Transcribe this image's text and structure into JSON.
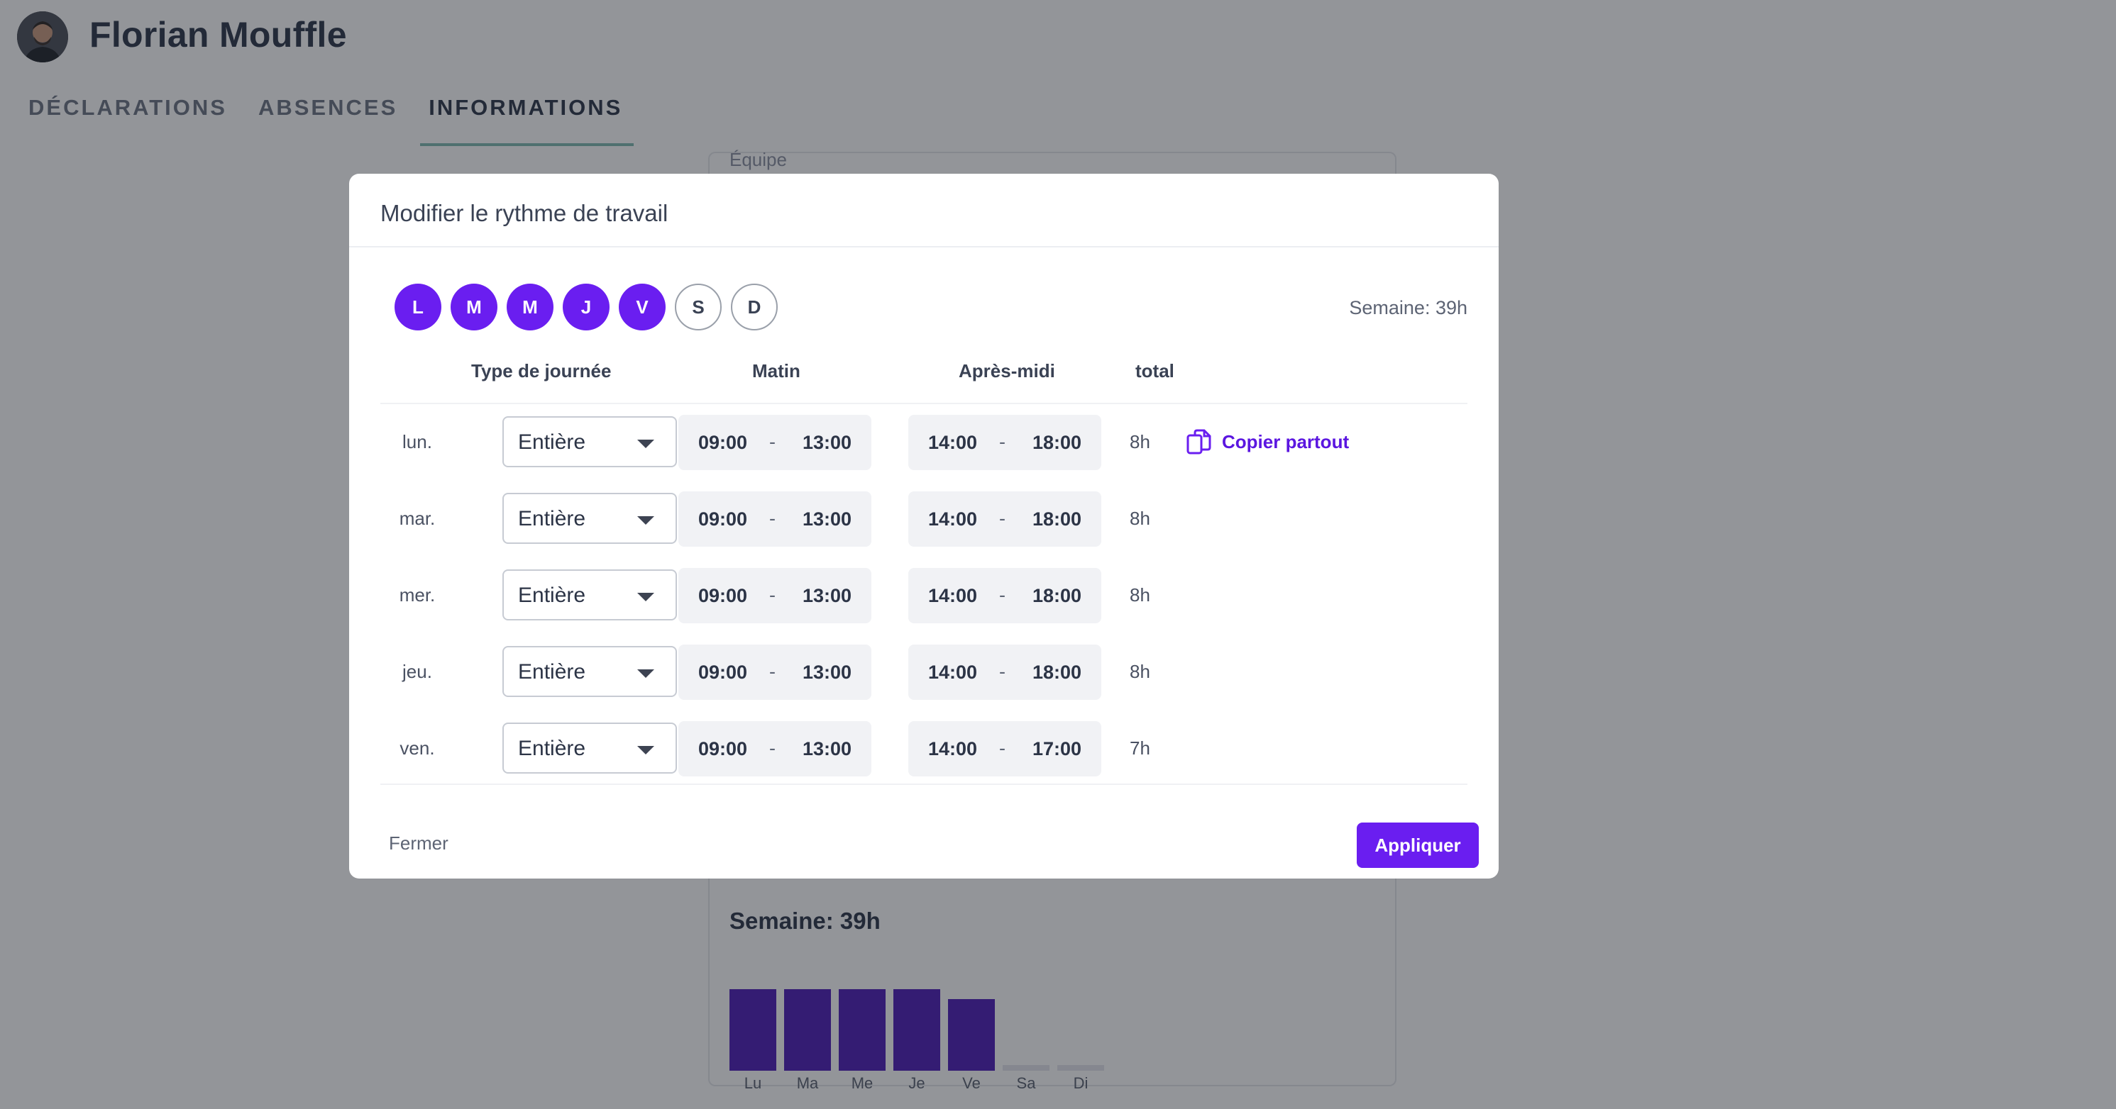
{
  "user": {
    "name": "Florian Mouffle"
  },
  "tabs": [
    {
      "label": "DÉCLARATIONS",
      "active": false
    },
    {
      "label": "ABSENCES",
      "active": false
    },
    {
      "label": "INFORMATIONS",
      "active": true
    }
  ],
  "background_card": {
    "team_label": "Équipe",
    "week_title": "Semaine: 39h",
    "chart_data": {
      "type": "bar",
      "categories": [
        "Lu",
        "Ma",
        "Me",
        "Je",
        "Ve",
        "Sa",
        "Di"
      ],
      "values": [
        8,
        8,
        8,
        8,
        7,
        0,
        0
      ],
      "unit": "h"
    }
  },
  "modal": {
    "title": "Modifier le rythme de travail",
    "week_total": "Semaine: 39h",
    "day_pills": [
      {
        "letter": "L",
        "active": true
      },
      {
        "letter": "M",
        "active": true
      },
      {
        "letter": "M",
        "active": true
      },
      {
        "letter": "J",
        "active": true
      },
      {
        "letter": "V",
        "active": true
      },
      {
        "letter": "S",
        "active": false
      },
      {
        "letter": "D",
        "active": false
      }
    ],
    "columns": {
      "day_type": "Type de journée",
      "morning": "Matin",
      "afternoon": "Après-midi",
      "total": "total"
    },
    "rows": [
      {
        "day": "lun.",
        "type": "Entière",
        "am_start": "09:00",
        "am_end": "13:00",
        "pm_start": "14:00",
        "pm_end": "18:00",
        "total": "8h"
      },
      {
        "day": "mar.",
        "type": "Entière",
        "am_start": "09:00",
        "am_end": "13:00",
        "pm_start": "14:00",
        "pm_end": "18:00",
        "total": "8h"
      },
      {
        "day": "mer.",
        "type": "Entière",
        "am_start": "09:00",
        "am_end": "13:00",
        "pm_start": "14:00",
        "pm_end": "18:00",
        "total": "8h"
      },
      {
        "day": "jeu.",
        "type": "Entière",
        "am_start": "09:00",
        "am_end": "13:00",
        "pm_start": "14:00",
        "pm_end": "18:00",
        "total": "8h"
      },
      {
        "day": "ven.",
        "type": "Entière",
        "am_start": "09:00",
        "am_end": "13:00",
        "pm_start": "14:00",
        "pm_end": "17:00",
        "total": "7h"
      }
    ],
    "copy_all_label": "Copier partout",
    "close_label": "Fermer",
    "apply_label": "Appliquer",
    "dash": "-"
  },
  "colors": {
    "accent": "#6a1ef0",
    "chart_bar": "#4c1bb8",
    "tab_underline": "#7fb9b0"
  },
  "icons": {
    "copy": "copy-icon",
    "dropdown": "chevron-down-icon"
  }
}
